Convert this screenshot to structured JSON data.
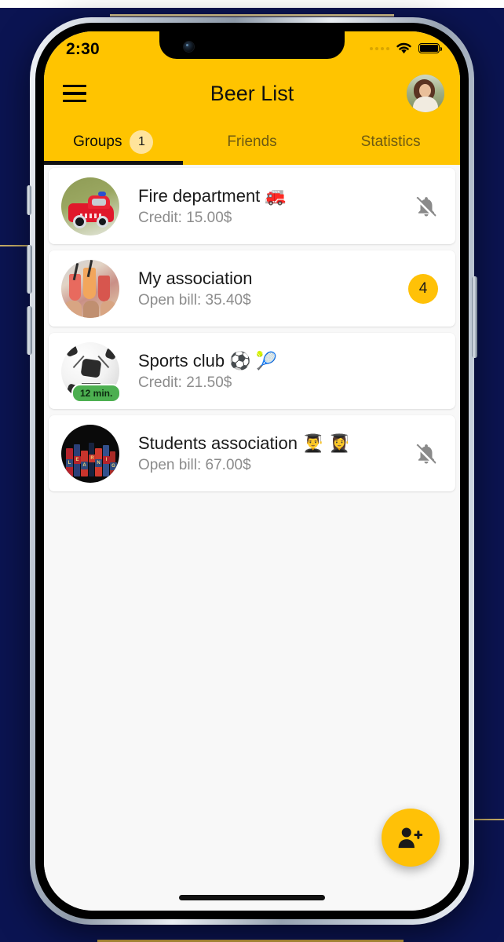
{
  "status_bar": {
    "time": "2:30",
    "signal_icon": "signal-dots-icon",
    "wifi_icon": "wifi-icon",
    "battery_icon": "battery-full-icon"
  },
  "app_bar": {
    "menu_icon": "hamburger-menu-icon",
    "title": "Beer List",
    "avatar": "profile-avatar"
  },
  "tabs": [
    {
      "label": "Groups",
      "badge": "1",
      "active": true
    },
    {
      "label": "Friends",
      "badge": null,
      "active": false
    },
    {
      "label": "Statistics",
      "badge": null,
      "active": false
    }
  ],
  "groups": [
    {
      "title": "Fire department 🚒",
      "subtitle": "Credit: 15.00$",
      "trailing_type": "bell-off",
      "badge": null,
      "time_badge": null,
      "avatar": "fire-truck-photo"
    },
    {
      "title": "My association",
      "subtitle": "Open bill: 35.40$",
      "trailing_type": "count",
      "badge": "4",
      "time_badge": null,
      "avatar": "drinks-toast-photo"
    },
    {
      "title": "Sports club ⚽ 🎾",
      "subtitle": "Credit: 21.50$",
      "trailing_type": "none",
      "badge": null,
      "time_badge": "12 min.",
      "avatar": "soccer-ball-photo"
    },
    {
      "title": "Students association 👨‍🎓 👩‍🎓",
      "subtitle": "Open bill: 67.00$",
      "trailing_type": "bell-off",
      "badge": null,
      "time_badge": null,
      "avatar": "books-photo"
    }
  ],
  "fab": {
    "icon": "person-add-icon"
  },
  "colors": {
    "accent": "#FFC400",
    "badge_soft": "#FFE49B",
    "badge_strong": "#FFC107",
    "backdrop": "#0b1452",
    "content_bg": "#f8f8f8",
    "time_badge_green": "#4CAF50",
    "muted_text": "#8c8c8c"
  }
}
